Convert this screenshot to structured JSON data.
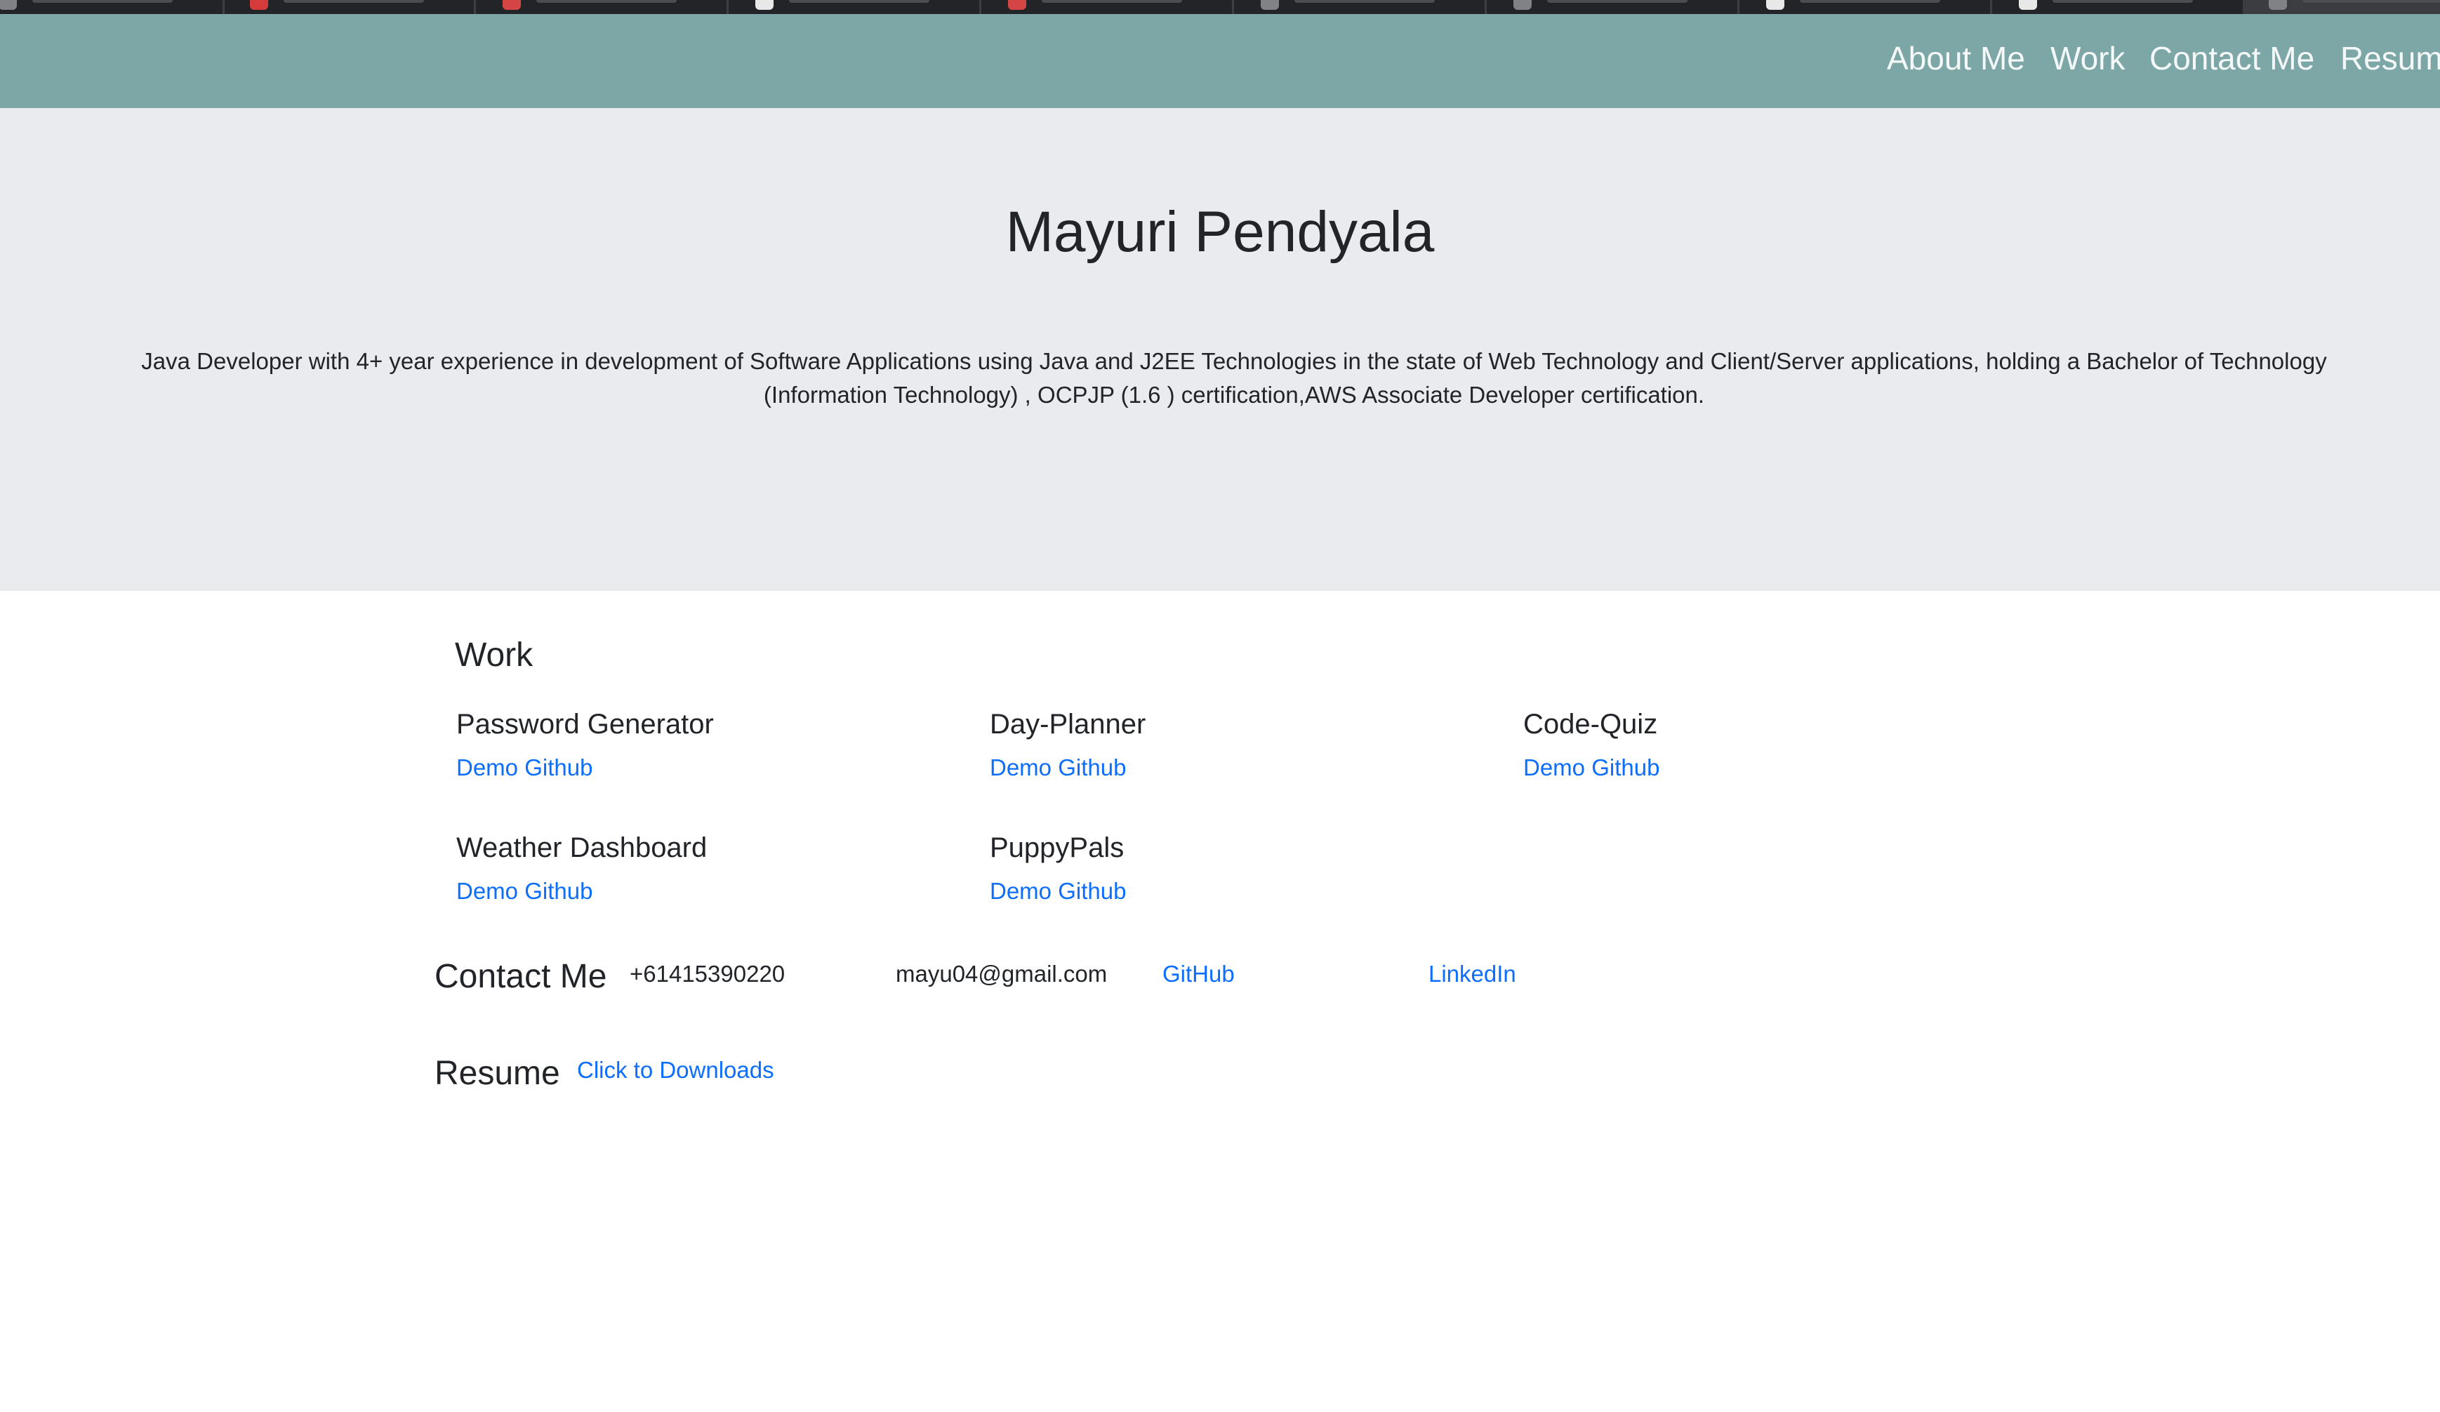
{
  "nav": {
    "items": [
      "About Me",
      "Work",
      "Contact Me",
      "Resum"
    ]
  },
  "hero": {
    "name": "Mayuri Pendyala",
    "bio_line1": "Java Developer with 4+ year experience in development of Software Applications using Java and J2EE Technologies in the state of Web Technology and Client/Server applications, holding a Bachelor of Technology (Information",
    "bio_line2": "Technology) , OCPJP (1.6 ) certification,AWS Associate Developer certification."
  },
  "work": {
    "heading": "Work",
    "projects": [
      {
        "title": "Password Generator",
        "demo": "Demo",
        "github": "Github"
      },
      {
        "title": "Day-Planner",
        "demo": "Demo",
        "github": "Github"
      },
      {
        "title": "Code-Quiz",
        "demo": "Demo",
        "github": "Github"
      },
      {
        "title": "Weather Dashboard",
        "demo": "Demo",
        "github": "Github"
      },
      {
        "title": "PuppyPals",
        "demo": "Demo",
        "github": "Github"
      }
    ]
  },
  "contact": {
    "heading": "Contact Me",
    "phone": "+61415390220",
    "email": "mayu04@gmail.com",
    "github": "GitHub",
    "linkedin": "LinkedIn"
  },
  "resume": {
    "heading": "Resume",
    "link": "Click to Downloads"
  },
  "colors": {
    "navbar": "#7ca7a6",
    "hero_bg": "#e9ebef",
    "link": "#0d6efd",
    "text": "#212529"
  }
}
